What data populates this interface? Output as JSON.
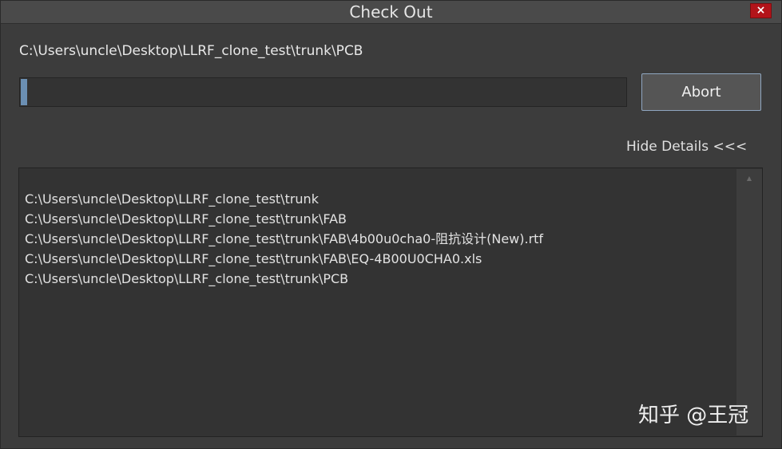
{
  "window": {
    "title": "Check Out",
    "close_label": "×"
  },
  "current_path": "C:\\Users\\uncle\\Desktop\\LLRF_clone_test\\trunk\\PCB",
  "progress": {
    "percent": 1,
    "fill_color": "#6b8fb3"
  },
  "abort_label": "Abort",
  "hide_details_label": "Hide Details <<<",
  "details": {
    "items": [
      "C:\\Users\\uncle\\Desktop\\LLRF_clone_test\\trunk",
      "C:\\Users\\uncle\\Desktop\\LLRF_clone_test\\trunk\\FAB",
      "C:\\Users\\uncle\\Desktop\\LLRF_clone_test\\trunk\\FAB\\4b00u0cha0-阻抗设计(New).rtf",
      "C:\\Users\\uncle\\Desktop\\LLRF_clone_test\\trunk\\FAB\\EQ-4B00U0CHA0.xls",
      "C:\\Users\\uncle\\Desktop\\LLRF_clone_test\\trunk\\PCB"
    ]
  },
  "scroll_up_icon": "▲",
  "watermark": "知乎 @王冠"
}
